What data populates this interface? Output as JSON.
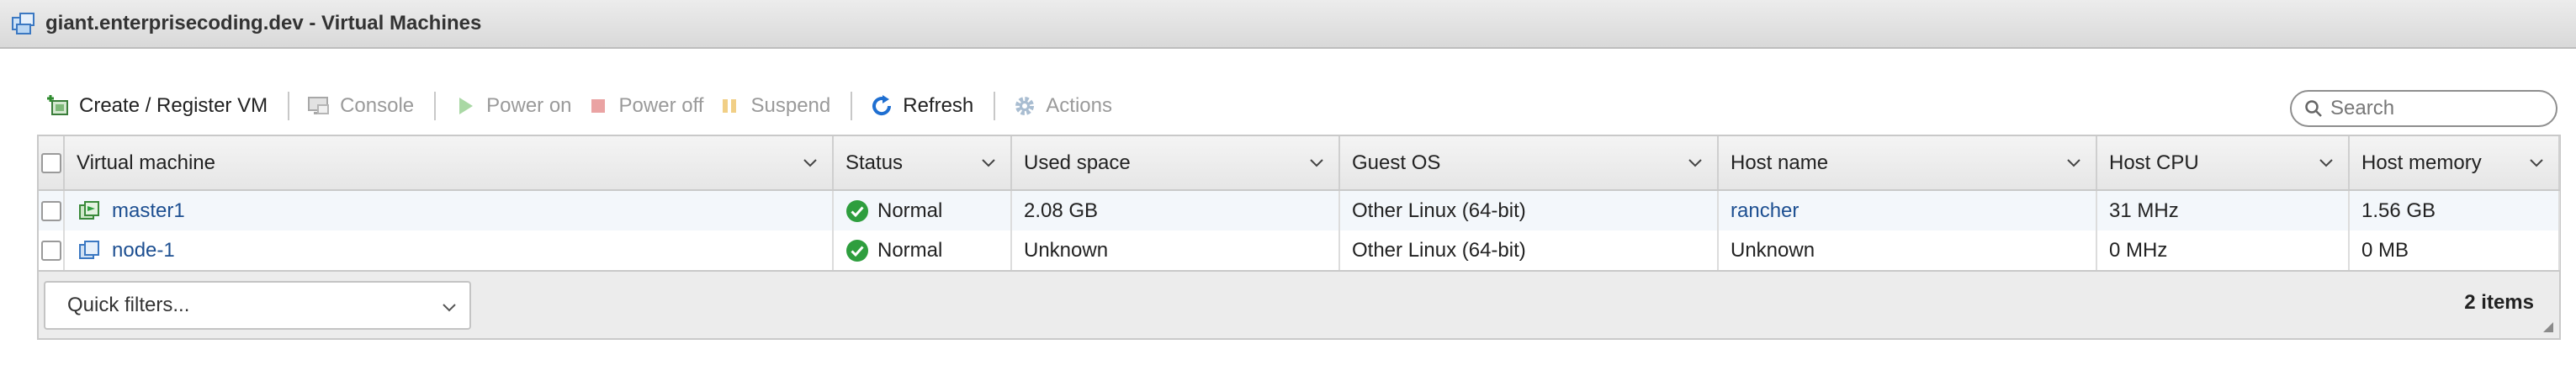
{
  "window": {
    "title": "giant.enterprisecoding.dev - Virtual Machines"
  },
  "toolbar": {
    "create_label": "Create / Register VM",
    "console_label": "Console",
    "power_on_label": "Power on",
    "power_off_label": "Power off",
    "suspend_label": "Suspend",
    "refresh_label": "Refresh",
    "actions_label": "Actions"
  },
  "search": {
    "placeholder": "Search",
    "value": ""
  },
  "table": {
    "columns": [
      "Virtual machine",
      "Status",
      "Used space",
      "Guest OS",
      "Host name",
      "Host CPU",
      "Host memory"
    ],
    "rows": [
      {
        "vm": "master1",
        "status": "Normal",
        "used_space": "2.08 GB",
        "guest_os": "Other Linux (64-bit)",
        "host_name": "rancher",
        "host_cpu": "31 MHz",
        "host_memory": "1.56 GB"
      },
      {
        "vm": "node-1",
        "status": "Normal",
        "used_space": "Unknown",
        "guest_os": "Other Linux (64-bit)",
        "host_name": "Unknown",
        "host_cpu": "0 MHz",
        "host_memory": "0 MB"
      }
    ]
  },
  "footer": {
    "quick_filters_label": "Quick filters...",
    "item_count": "2 items"
  },
  "colors": {
    "link": "#1d4f91",
    "status_ok": "#2e9e3e",
    "refresh_blue": "#1f6fd1",
    "disabled_text": "#9a9a9a"
  }
}
